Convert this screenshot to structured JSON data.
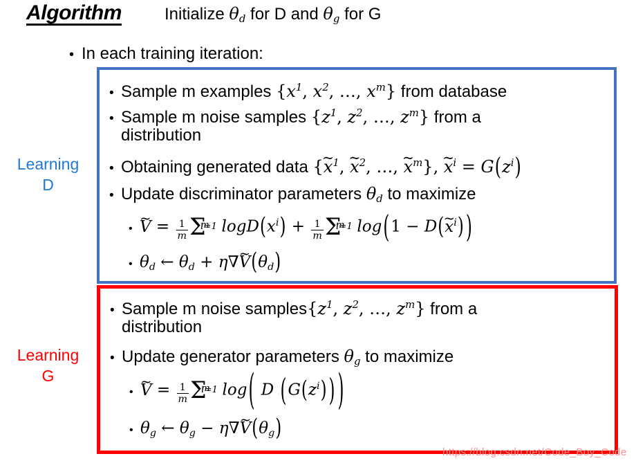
{
  "header": {
    "algorithm_label": "Algorithm",
    "initialize_statement": "Initialize θd for D and θg for G",
    "initialize_prefix": "Initialize ",
    "initialize_middle": " for D and ",
    "initialize_suffix": " for G",
    "theta": "θ",
    "sub_d": "d",
    "sub_g": "g"
  },
  "outline": {
    "iteration_bullet": "In each training iteration:",
    "bullet_glyph": "•"
  },
  "side_labels": {
    "learning_d": "Learning D",
    "learning_d_line1": "Learning",
    "learning_d_line2": "D",
    "learning_g": "Learning G",
    "learning_g_line1": "Learning",
    "learning_g_line2": "G",
    "learning_d_color": "#1f7ad4",
    "learning_g_color": "#fe0000"
  },
  "boxes": {
    "blue_border_color": "#4472c4",
    "red_border_color": "#fe0000"
  },
  "learning_d_steps": [
    {
      "id": "sample-m-examples",
      "text_before": "Sample m examples {",
      "set": "x¹, x², …, xᵐ",
      "text_after": "} from database"
    },
    {
      "id": "sample-m-noise",
      "text_before": "Sample m noise samples {",
      "set": "z¹, z², …, zᵐ",
      "text_after": "} from a distribution"
    },
    {
      "id": "obtaining-generated-data",
      "text_before": "Obtaining generated data {",
      "set": "x̃¹, x̃², …, x̃ᵐ",
      "text_after": "}, x̃ⁱ = G(zⁱ)"
    },
    {
      "id": "update-discriminator",
      "text_before": "Update discriminator parameters ",
      "symbol": "θd",
      "text_after": " to maximize"
    }
  ],
  "learning_d_formulas": [
    {
      "id": "v-tilde-discriminator",
      "latex": "Ṽ = (1/m) Σᵢ₌₁ᵐ logD(xⁱ) + (1/m) Σᵢ₌₁ᵐ log(1 − D(x̃ⁱ))"
    },
    {
      "id": "theta-d-update",
      "latex": "θd ← θd + η∇Ṽ(θd)"
    }
  ],
  "learning_g_steps": [
    {
      "id": "sample-m-noise-g",
      "text_before": "Sample m noise samples{",
      "set": "z¹, z², …, zᵐ",
      "text_after": "} from a distribution"
    },
    {
      "id": "update-generator",
      "text_before": "Update generator parameters ",
      "symbol": "θg",
      "text_after": " to maximize"
    }
  ],
  "learning_g_formulas": [
    {
      "id": "v-tilde-generator",
      "latex": "Ṽ = (1/m) Σᵢ₌₁ᵐ log(D(G(zⁱ)))"
    },
    {
      "id": "theta-g-update",
      "latex": "θg ← θg − η∇Ṽ(θg)"
    }
  ],
  "math_tokens": {
    "theta": "θ",
    "eta": "η",
    "nabla": "∇",
    "sigma": "Σ",
    "leftarrow": "←",
    "plus": "+",
    "minus": "−",
    "equals": "=",
    "one": "1",
    "m": "m",
    "i_eq_1": "i=1",
    "log": "log",
    "D": "D",
    "G": "G",
    "V": "V",
    "x": "x",
    "z": "z",
    "i": "i",
    "d": "d",
    "g": "g",
    "tilde": "̃",
    "lbrace": "{",
    "rbrace": "}",
    "lparen": "(",
    "rparen": ")",
    "comma": ",",
    "ellipsis": "…",
    "sup_1": "1",
    "sup_2": "2",
    "sup_m": "m",
    "sup_i": "i"
  },
  "text_fragments": {
    "sample_m_examples": "Sample m examples ",
    "from_database": " from database",
    "sample_m_noise_samples_sp": "Sample m noise samples ",
    "sample_m_noise_samples_nosp": "Sample m noise samples",
    "from_a": " from a",
    "distribution": "distribution",
    "obtaining_generated_data": "Obtaining generated data ",
    "update_discriminator_parameters": "Update discriminator parameters ",
    "update_generator_parameters": "Update generator parameters ",
    "to_maximize": " to maximize"
  },
  "watermark": {
    "text": "https://blog.csdn.net/Code_Boy_Code",
    "color": "#ff8c8c"
  }
}
